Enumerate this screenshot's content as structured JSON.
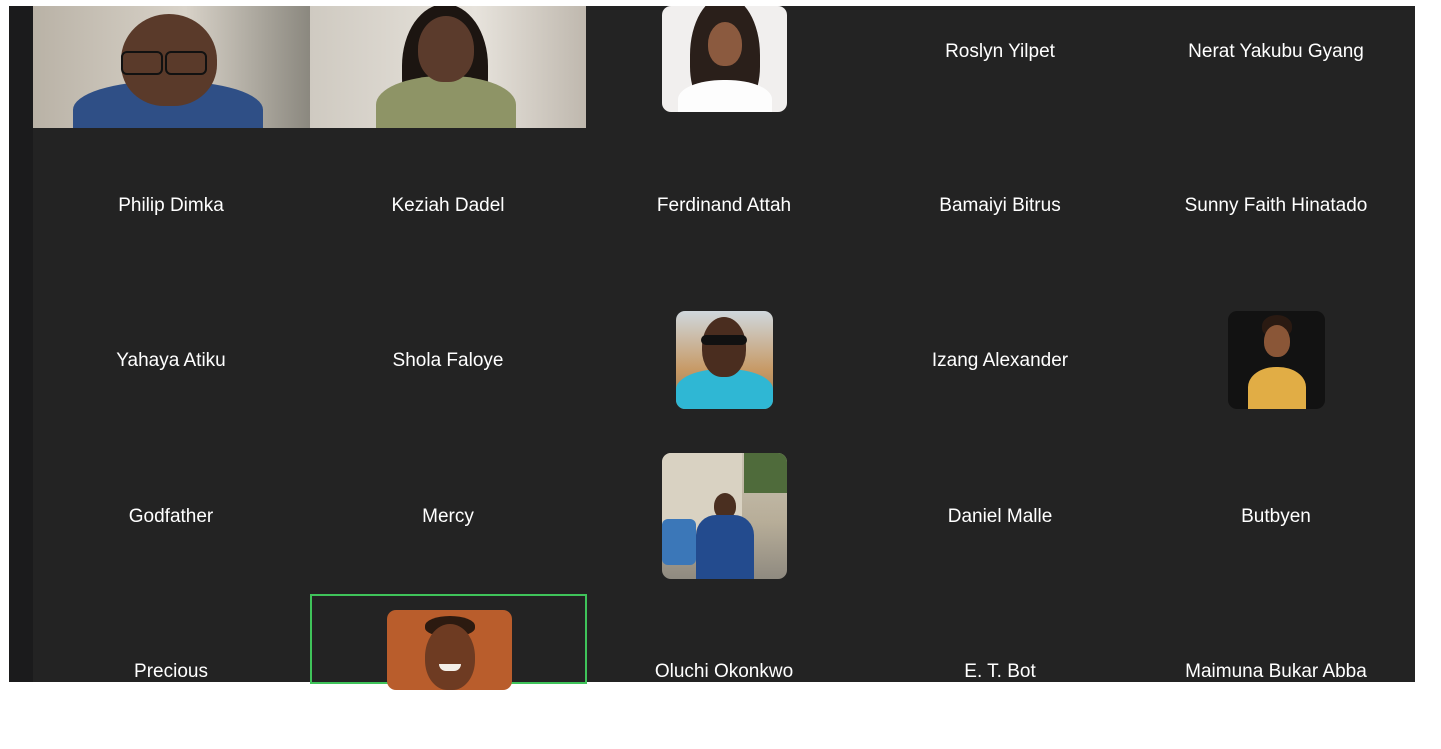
{
  "meeting": {
    "participants": [
      {
        "id": "p1",
        "name": "",
        "kind": "video"
      },
      {
        "id": "p2",
        "name": "",
        "kind": "video"
      },
      {
        "id": "p3",
        "name": "",
        "kind": "avatar"
      },
      {
        "id": "p4",
        "name": "Roslyn Yilpet",
        "kind": "name"
      },
      {
        "id": "p5",
        "name": "Nerat Yakubu Gyang",
        "kind": "name"
      },
      {
        "id": "p6",
        "name": "Philip Dimka",
        "kind": "name"
      },
      {
        "id": "p7",
        "name": "Keziah Dadel",
        "kind": "name"
      },
      {
        "id": "p8",
        "name": "Ferdinand Attah",
        "kind": "name"
      },
      {
        "id": "p9",
        "name": "Bamaiyi Bitrus",
        "kind": "name"
      },
      {
        "id": "p10",
        "name": "Sunny Faith Hinatado",
        "kind": "name"
      },
      {
        "id": "p11",
        "name": "Yahaya Atiku",
        "kind": "name"
      },
      {
        "id": "p12",
        "name": "Shola Faloye",
        "kind": "name"
      },
      {
        "id": "p13",
        "name": "",
        "kind": "avatar"
      },
      {
        "id": "p14",
        "name": "Izang Alexander",
        "kind": "name"
      },
      {
        "id": "p15",
        "name": "",
        "kind": "avatar"
      },
      {
        "id": "p16",
        "name": "Godfather",
        "kind": "name"
      },
      {
        "id": "p17",
        "name": "Mercy",
        "kind": "name"
      },
      {
        "id": "p18",
        "name": "",
        "kind": "avatar"
      },
      {
        "id": "p19",
        "name": "Daniel Malle",
        "kind": "name"
      },
      {
        "id": "p20",
        "name": "Butbyen",
        "kind": "name"
      },
      {
        "id": "p21",
        "name": "Precious",
        "kind": "name"
      },
      {
        "id": "p22",
        "name": "",
        "kind": "avatar",
        "active_speaker": true
      },
      {
        "id": "p23",
        "name": "Oluchi Okonkwo",
        "kind": "name"
      },
      {
        "id": "p24",
        "name": "E. T. Bot",
        "kind": "name"
      },
      {
        "id": "p25",
        "name": "Maimuna Bukar Abba",
        "kind": "name"
      }
    ]
  },
  "colors": {
    "tile_background": "#232323",
    "frame_background": "#1b1b1c",
    "active_speaker_border": "#3fc35a",
    "name_text": "#ffffff"
  }
}
